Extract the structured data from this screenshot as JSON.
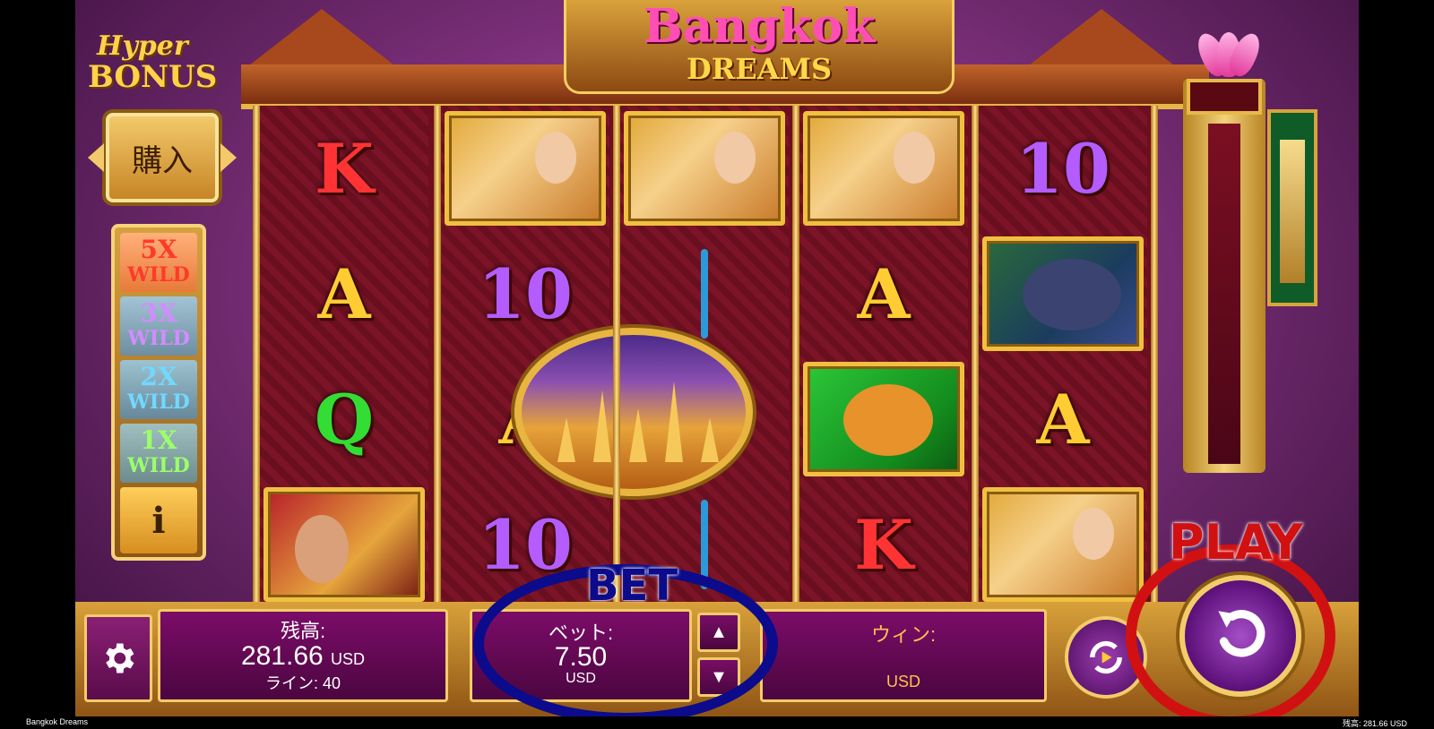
{
  "game": {
    "title_line1": "Bangkok",
    "title_line2": "DREAMS"
  },
  "hyper_bonus": {
    "line1": "Hyper",
    "line2": "BONUS",
    "buy_label": "購入"
  },
  "wild_multipliers": [
    {
      "mult": "5X",
      "word": "WILD"
    },
    {
      "mult": "3X",
      "word": "WILD"
    },
    {
      "mult": "2X",
      "word": "WILD"
    },
    {
      "mult": "1X",
      "word": "WILD"
    }
  ],
  "info_label": "i",
  "reels": [
    [
      "K",
      "A",
      "Q",
      "warrior-king"
    ],
    [
      "dancer",
      "10",
      "A",
      "10"
    ],
    [
      "dancer",
      "blue-bar",
      "temple-medallion",
      "blue-bar"
    ],
    [
      "dancer",
      "A",
      "tiger",
      "K"
    ],
    [
      "10",
      "elephant",
      "A",
      "dancer"
    ]
  ],
  "colors": {
    "K": "#ff3333",
    "A": "#ffcc33",
    "Q": "#33dd33",
    "10": "#b55cff",
    "frame_gold": "#f0c040",
    "panel_purple": "#7c0c68"
  },
  "controls": {
    "balance_label": "残高:",
    "balance_value": "281.66",
    "balance_currency": "USD",
    "lines_label": "ライン: 40",
    "bet_label": "ベット:",
    "bet_value": "7.50",
    "bet_currency": "USD",
    "win_label": "ウィン:",
    "win_currency": "USD",
    "bet_up": "▲",
    "bet_down": "▼"
  },
  "annotations": {
    "bet_text": "BET",
    "play_text": "PLAY"
  },
  "footer": {
    "left": "Bangkok Dreams",
    "right": "残高: 281.66 USD"
  }
}
